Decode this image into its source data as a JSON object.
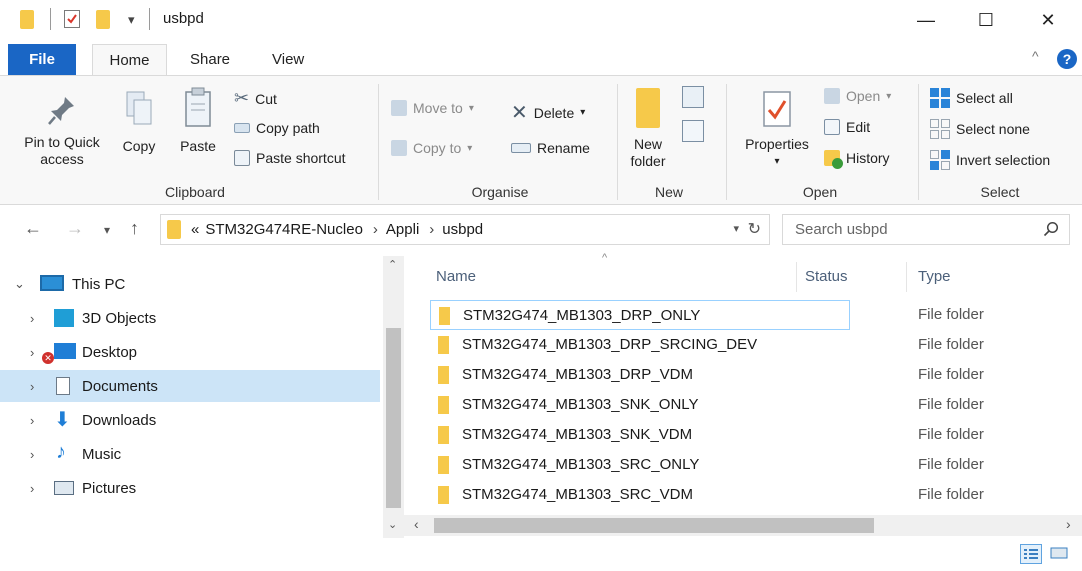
{
  "window": {
    "title": "usbpd",
    "minimize": "—",
    "maximize": "☐",
    "close": "✕"
  },
  "tabs": {
    "file": "File",
    "home": "Home",
    "share": "Share",
    "view": "View",
    "collapse": "^",
    "help": "?"
  },
  "ribbon": {
    "clipboard": {
      "label": "Clipboard",
      "pin": "Pin to Quick access",
      "copy": "Copy",
      "paste": "Paste",
      "cut": "Cut",
      "copy_path": "Copy path",
      "paste_shortcut": "Paste shortcut"
    },
    "organise": {
      "label": "Organise",
      "move_to": "Move to",
      "copy_to": "Copy to",
      "delete": "Delete",
      "rename": "Rename"
    },
    "new": {
      "label": "New",
      "new_folder": "New folder"
    },
    "open": {
      "label": "Open",
      "properties": "Properties",
      "open": "Open",
      "edit": "Edit",
      "history": "History"
    },
    "select": {
      "label": "Select",
      "select_all": "Select all",
      "select_none": "Select none",
      "invert": "Invert selection"
    }
  },
  "address": {
    "overflow": "«",
    "crumbs": [
      "STM32G474RE-Nucleo",
      "Appli",
      "usbpd"
    ],
    "search_placeholder": "Search usbpd"
  },
  "tree": [
    {
      "label": "This PC",
      "icon": "this-pc-icon",
      "selected": false
    },
    {
      "label": "3D Objects",
      "icon": "3d-objects-icon",
      "selected": false
    },
    {
      "label": "Desktop",
      "icon": "desktop-icon",
      "selected": false
    },
    {
      "label": "Documents",
      "icon": "documents-icon",
      "selected": true
    },
    {
      "label": "Downloads",
      "icon": "downloads-icon",
      "selected": false
    },
    {
      "label": "Music",
      "icon": "music-icon",
      "selected": false
    },
    {
      "label": "Pictures",
      "icon": "pictures-icon",
      "selected": false
    }
  ],
  "columns": {
    "name": "Name",
    "status": "Status",
    "type": "Type"
  },
  "files": [
    {
      "name": "STM32G474_MB1303_DRP_ONLY",
      "type": "File folder"
    },
    {
      "name": "STM32G474_MB1303_DRP_SRCING_DEV",
      "type": "File folder"
    },
    {
      "name": "STM32G474_MB1303_DRP_VDM",
      "type": "File folder"
    },
    {
      "name": "STM32G474_MB1303_SNK_ONLY",
      "type": "File folder"
    },
    {
      "name": "STM32G474_MB1303_SNK_VDM",
      "type": "File folder"
    },
    {
      "name": "STM32G474_MB1303_SRC_ONLY",
      "type": "File folder"
    },
    {
      "name": "STM32G474_MB1303_SRC_VDM",
      "type": "File folder"
    }
  ],
  "colors": {
    "accent": "#1a66c5",
    "selection": "#cce4f7",
    "folder": "#f6c94a"
  }
}
